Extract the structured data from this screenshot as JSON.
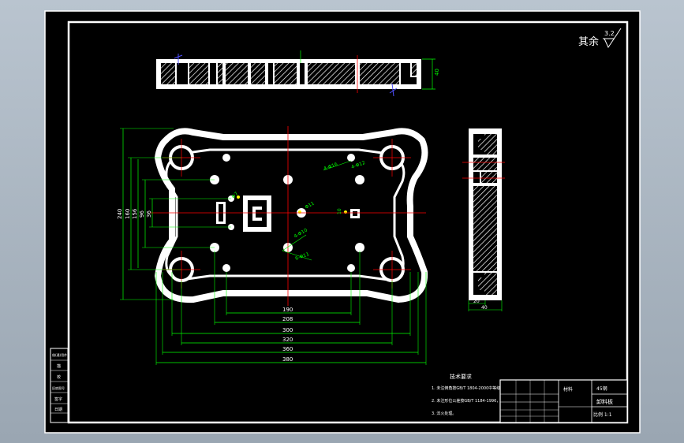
{
  "sheet": {
    "surface_note": "其余",
    "roughness_value": "3.2",
    "colors": {
      "background": "#000000",
      "outline": "#ffffff",
      "dimension": "#00ff00",
      "centerline": "#ff0000",
      "hatch": "#ffffff",
      "highlight": "#ffff00"
    }
  },
  "top_view": {
    "height_dim": "40"
  },
  "plan_view": {
    "vertical_dims": [
      "240",
      "160",
      "156",
      "96",
      "36"
    ],
    "horizontal_dims": [
      "190",
      "208",
      "300",
      "320",
      "360",
      "380"
    ],
    "hole_callouts": [
      "4-Φ16",
      "4-Φ12",
      "Φ7",
      "Φ11",
      "4-Φ10",
      "6-Φ11",
      "10"
    ]
  },
  "side_view": {
    "dims": [
      "20",
      "40"
    ]
  },
  "notes": {
    "title": "技术要求",
    "lines": [
      "1. 未注倒角按GB/T 1804-2000中等级。",
      "2. 未注形位公差按GB/T 1184-1996，H级。",
      "3. 淬火处理。"
    ]
  },
  "title_block": {
    "cells": [
      "材料",
      "卸料板",
      "45钢",
      "比例 1:1"
    ]
  },
  "side_table": {
    "rows": [
      "借(通)用件",
      "描",
      "校",
      "旧底图号",
      "签字",
      "日期"
    ]
  }
}
